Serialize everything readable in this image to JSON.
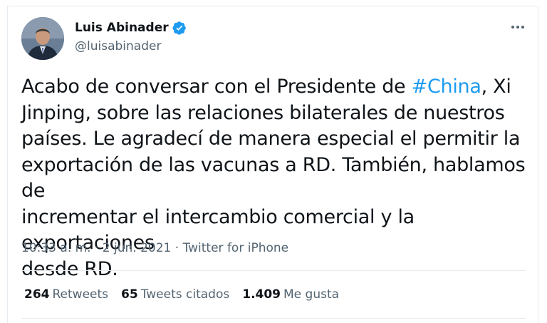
{
  "author": {
    "name": "Luis Abinader",
    "handle": "@luisabinader"
  },
  "tweet": {
    "text_before_hashtag": "Acabo de conversar con el Presidente de ",
    "hashtag": "#China",
    "text_after_hashtag": ", Xi\nJinping, sobre las relaciones bilaterales de nuestros\npaíses. Le agradecí de manera especial el permitir la\nexportación de las vacunas a RD. También, hablamos de\nincrementar el intercambio comercial y la exportaciones\ndesde RD."
  },
  "meta": {
    "timestamp": "10:33 a. m. · 2 jun. 2021 · Twitter for iPhone"
  },
  "stats": [
    {
      "count": "264",
      "label": "Retweets"
    },
    {
      "count": "65",
      "label": "Tweets citados"
    },
    {
      "count": "1.409",
      "label": "Me gusta"
    }
  ],
  "colors": {
    "accent": "#1d9bf0",
    "text": "#0f1419",
    "muted": "#536471",
    "border": "#e6ecf0"
  },
  "icons": {
    "verified": "verified-badge-icon",
    "more": "more-options-icon"
  }
}
